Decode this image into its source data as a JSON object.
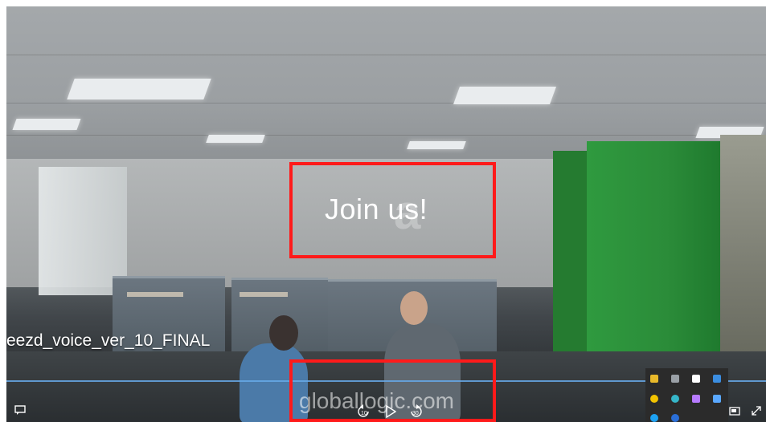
{
  "video": {
    "caption": "Join us!",
    "watermark_letter": "a",
    "title": "eezd_voice_ver_10_FINAL",
    "site_text": "globallogic.com"
  },
  "controls": {
    "skip_back_label": "10",
    "skip_forward_label": "30",
    "progress": 1.0
  },
  "colors": {
    "annotation": "#ff1a1a",
    "progress": "#66a9e8"
  },
  "tray_icons": [
    "shield-icon",
    "notes-icon",
    "snip-icon",
    "calendar-icon",
    "chrome-icon",
    "edge-icon",
    "pen-icon",
    "cloud-icon",
    "skype-icon",
    "bluetooth-icon"
  ]
}
